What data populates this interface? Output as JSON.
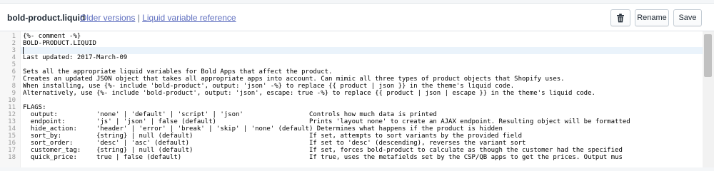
{
  "header": {
    "file_name": "bold-product.liquid",
    "older_versions": "Older versions",
    "separator": "|",
    "liquid_reference": "Liquid variable reference",
    "delete_icon": "trash-icon",
    "rename_label": "Rename",
    "save_label": "Save"
  },
  "editor": {
    "line_numbers": [
      "1",
      "2",
      "3",
      "4",
      "5",
      "6",
      "7",
      "8",
      "9",
      "10",
      "11",
      "12",
      "13",
      "14",
      "15",
      "16",
      "17",
      "18"
    ],
    "lines": [
      "{%- comment -%}",
      "BOLD-PRODUCT.LIQUID",
      "",
      "Last updated: 2017-March-09",
      "",
      "Sets all the appropriate liquid variables for Bold Apps that affect the product.",
      "Creates an updated JSON object that takes all appropriate apps into account. Can mimic all three types of product objects that Shopify uses.",
      "When installing, use {%- include 'bold-product', output: 'json' -%} to replace {{ product | json }} in the theme's liquid code.",
      "Alternatively, use {%- include 'bold-product', output: 'json', escape: true -%} to replace {{ product | json | escape }} in the theme's liquid code.",
      "",
      "FLAGS:",
      "  output:          'none' | 'default' | 'script' | 'json'                 Controls how much data is printed",
      "  endpoint:        'js' | 'json' | false (default)                        Prints 'layout none' to create an AJAX endpoint. Resulting object will be formatted",
      "  hide_action:     'header' | 'error' | 'break' | 'skip' | 'none' (default) Determines what happens if the product is hidden",
      "  sort_by:         {string} | null (default)                              If set, attempts to sort variants by the provided field",
      "  sort_order:      'desc' | 'asc' (default)                               If set to 'desc' (descending), reverses the variant sort",
      "  customer_tag:    {string} | null (default)                              If set, forces bold-product to calculate as though the customer had the specified",
      "  quick_price:     true | false (default)                                 If true, uses the metafields set by the CSP/QB apps to get the prices. Output mus"
    ]
  }
}
